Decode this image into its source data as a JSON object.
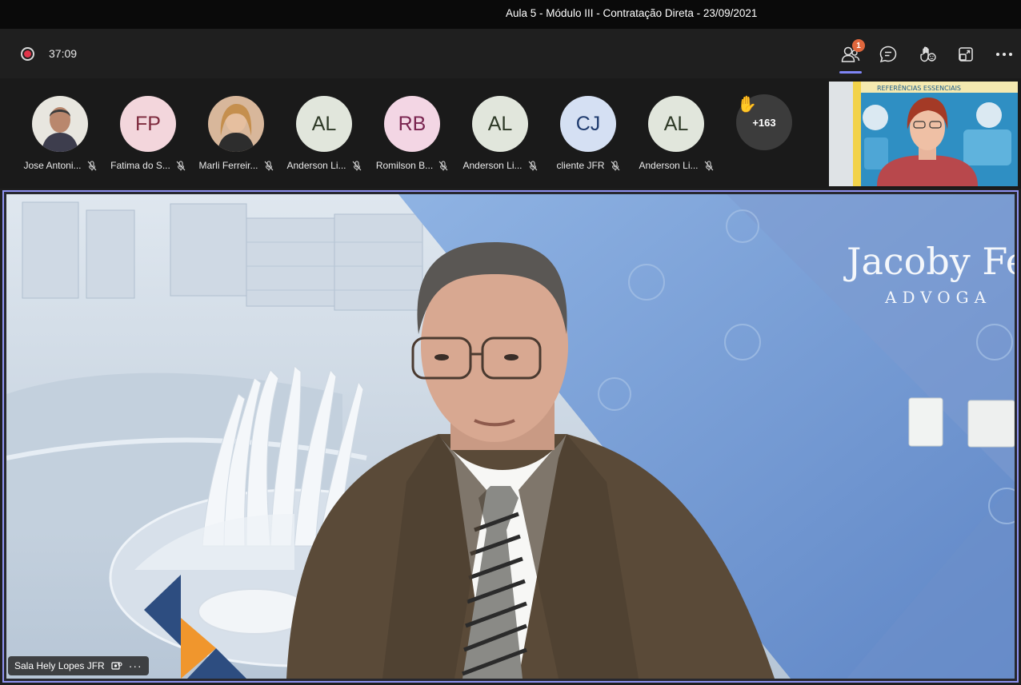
{
  "window": {
    "title": "Aula 5 - Módulo III - Contratação Direta - 23/09/2021"
  },
  "toolbar": {
    "timer": "37:09",
    "people_badge": "1",
    "icons": [
      "record-icon",
      "people-icon",
      "chat-icon",
      "raise-hand-icon",
      "share-tray-icon",
      "more-options-icon"
    ]
  },
  "participants": [
    {
      "name": "Jose Antoni...",
      "initials": "",
      "photo": true,
      "color": "#4a4a4a"
    },
    {
      "name": "Fatima do S...",
      "initials": "FP",
      "photo": false,
      "bg": "#f3d6dc",
      "fg": "#7d2a3d"
    },
    {
      "name": "Marli Ferreir...",
      "initials": "",
      "photo": true,
      "color": "#c79270"
    },
    {
      "name": "Anderson Li...",
      "initials": "AL",
      "photo": false,
      "bg": "#e1e6dc",
      "fg": "#2e3a27"
    },
    {
      "name": "Romilson B...",
      "initials": "RB",
      "photo": false,
      "bg": "#f3d6e4",
      "fg": "#7a2450"
    },
    {
      "name": "Anderson Li...",
      "initials": "AL",
      "photo": false,
      "bg": "#e1e6dc",
      "fg": "#2e3a27"
    },
    {
      "name": "cliente JFR",
      "initials": "CJ",
      "photo": false,
      "bg": "#d5e0f3",
      "fg": "#1f3b6e"
    },
    {
      "name": "Anderson Li...",
      "initials": "AL",
      "photo": false,
      "bg": "#e1e6dc",
      "fg": "#2e3a27"
    }
  ],
  "overflow_count": "+163",
  "stage": {
    "presenter_tag": "Sala Hely Lopes JFR",
    "more": "···",
    "backdrop_logo": "Jacoby Fe",
    "backdrop_sub": "ADVOGA"
  },
  "self_view": {
    "banner_text": "REFERÊNCIAS ESSENCIAIS"
  }
}
